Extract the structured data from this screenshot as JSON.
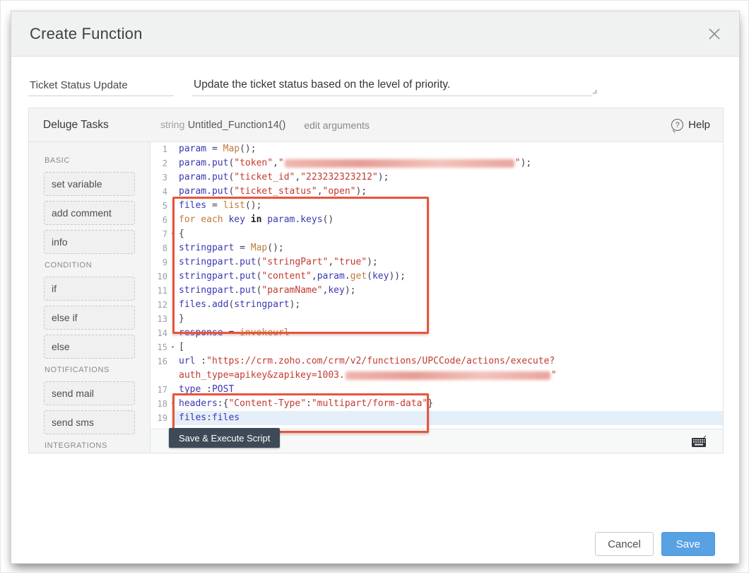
{
  "dialog": {
    "title": "Create Function"
  },
  "fields": {
    "name_value": "Ticket Status Update",
    "description_value": "Update the ticket status based on the level of priority."
  },
  "panel": {
    "title": "Deluge Tasks",
    "signature_type": "string",
    "signature_name": "Untitled_Function14()",
    "edit_arguments": "edit arguments",
    "help_label": "Help"
  },
  "sidebar": {
    "sections": [
      {
        "label": "BASIC",
        "items": [
          "set variable",
          "add comment",
          "info"
        ]
      },
      {
        "label": "CONDITION",
        "items": [
          "if",
          "else if",
          "else"
        ]
      },
      {
        "label": "NOTIFICATIONS",
        "items": [
          "send mail",
          "send sms"
        ]
      },
      {
        "label": "INTEGRATIONS",
        "items": []
      }
    ]
  },
  "editor": {
    "active_line": "19",
    "save_execute_label": "Save & Execute Script",
    "lines": [
      {
        "n": "1",
        "segs": [
          [
            "id",
            "param"
          ],
          [
            "p",
            " = "
          ],
          [
            "fn",
            "Map"
          ],
          [
            "p",
            "();"
          ]
        ]
      },
      {
        "n": "2",
        "segs": [
          [
            "id",
            "param.put"
          ],
          [
            "p",
            "("
          ],
          [
            "s",
            "\"token\""
          ],
          [
            "p",
            ","
          ],
          [
            "s",
            "\""
          ],
          [
            "r",
            "325"
          ],
          [
            "s",
            "\""
          ],
          [
            "p",
            ");"
          ]
        ]
      },
      {
        "n": "3",
        "segs": [
          [
            "id",
            "param.put"
          ],
          [
            "p",
            "("
          ],
          [
            "s",
            "\"ticket_id\""
          ],
          [
            "p",
            ","
          ],
          [
            "s",
            "\"223232323212\""
          ],
          [
            "p",
            ");"
          ]
        ]
      },
      {
        "n": "4",
        "segs": [
          [
            "id",
            "param.put"
          ],
          [
            "p",
            "("
          ],
          [
            "s",
            "\"ticket_status\""
          ],
          [
            "p",
            ","
          ],
          [
            "s",
            "\"open\""
          ],
          [
            "p",
            ");"
          ]
        ]
      },
      {
        "n": "5",
        "segs": [
          [
            "id",
            "files"
          ],
          [
            "p",
            " = "
          ],
          [
            "fn",
            "list"
          ],
          [
            "p",
            "();"
          ]
        ]
      },
      {
        "n": "6",
        "segs": [
          [
            "fn",
            "for each "
          ],
          [
            "id",
            "key"
          ],
          [
            "kw",
            " in "
          ],
          [
            "id",
            "param.keys"
          ],
          [
            "p",
            "()"
          ]
        ]
      },
      {
        "n": "7",
        "fold": true,
        "segs": [
          [
            "p",
            "{"
          ]
        ]
      },
      {
        "n": "8",
        "segs": [
          [
            "id",
            "stringpart"
          ],
          [
            "p",
            " = "
          ],
          [
            "fn",
            "Map"
          ],
          [
            "p",
            "();"
          ]
        ]
      },
      {
        "n": "9",
        "segs": [
          [
            "id",
            "stringpart.put"
          ],
          [
            "p",
            "("
          ],
          [
            "s",
            "\"stringPart\""
          ],
          [
            "p",
            ","
          ],
          [
            "s",
            "\"true\""
          ],
          [
            "p",
            ");"
          ]
        ]
      },
      {
        "n": "10",
        "segs": [
          [
            "id",
            "stringpart.put"
          ],
          [
            "p",
            "("
          ],
          [
            "s",
            "\"content\""
          ],
          [
            "p",
            ","
          ],
          [
            "id",
            "param"
          ],
          [
            "p",
            "."
          ],
          [
            "fn",
            "get"
          ],
          [
            "p",
            "("
          ],
          [
            "id",
            "key"
          ],
          [
            "p",
            "));"
          ]
        ]
      },
      {
        "n": "11",
        "segs": [
          [
            "id",
            "stringpart.put"
          ],
          [
            "p",
            "("
          ],
          [
            "s",
            "\"paramName\""
          ],
          [
            "p",
            ","
          ],
          [
            "id",
            "key"
          ],
          [
            "p",
            ");"
          ]
        ]
      },
      {
        "n": "12",
        "segs": [
          [
            "id",
            "files.add"
          ],
          [
            "p",
            "("
          ],
          [
            "id",
            "stringpart"
          ],
          [
            "p",
            ");"
          ]
        ]
      },
      {
        "n": "13",
        "segs": [
          [
            "p",
            "}"
          ]
        ]
      },
      {
        "n": "14",
        "segs": [
          [
            "id",
            "response"
          ],
          [
            "p",
            " = "
          ],
          [
            "fn",
            "invokeurl"
          ]
        ]
      },
      {
        "n": "15",
        "fold": true,
        "segs": [
          [
            "p",
            "["
          ]
        ]
      },
      {
        "n": "16",
        "segs": [
          [
            "id",
            "url"
          ],
          [
            "p",
            " :"
          ],
          [
            "s",
            "\"https://crm.zoho.com/crm/v2/functions/UPCCode/actions/execute?"
          ]
        ]
      },
      {
        "n": "",
        "segs": [
          [
            "s",
            "auth_type=apikey&zapikey=1003."
          ],
          [
            "r",
            "290"
          ],
          [
            "s",
            "\""
          ]
        ]
      },
      {
        "n": "17",
        "segs": [
          [
            "id",
            "type"
          ],
          [
            "p",
            " :"
          ],
          [
            "id",
            "POST"
          ]
        ]
      },
      {
        "n": "18",
        "fold": true,
        "segs": [
          [
            "id",
            "headers"
          ],
          [
            "p",
            ":{"
          ],
          [
            "s",
            "\"Content-Type\""
          ],
          [
            "p",
            ":"
          ],
          [
            "s",
            "\"multipart/form-data\""
          ],
          [
            "p",
            "}"
          ]
        ]
      },
      {
        "n": "19",
        "active": true,
        "segs": [
          [
            "id",
            "files"
          ],
          [
            "p",
            ":"
          ],
          [
            "id",
            "files"
          ]
        ]
      }
    ]
  },
  "footer": {
    "cancel_label": "Cancel",
    "save_label": "Save"
  },
  "icons": {
    "help": "?",
    "fold": "▾",
    "close": "close-x",
    "keyboard": "keyboard"
  },
  "colors": {
    "primary_button": "#58a1e3",
    "annotation_box": "#e8543c",
    "active_line_bg": "#e5effa",
    "header_bg": "#f0f1f1",
    "code_identifier": "#3a39b4",
    "code_string": "#c13a30",
    "code_function": "#c07a3a",
    "save_exec_bg": "#3e4a57"
  }
}
